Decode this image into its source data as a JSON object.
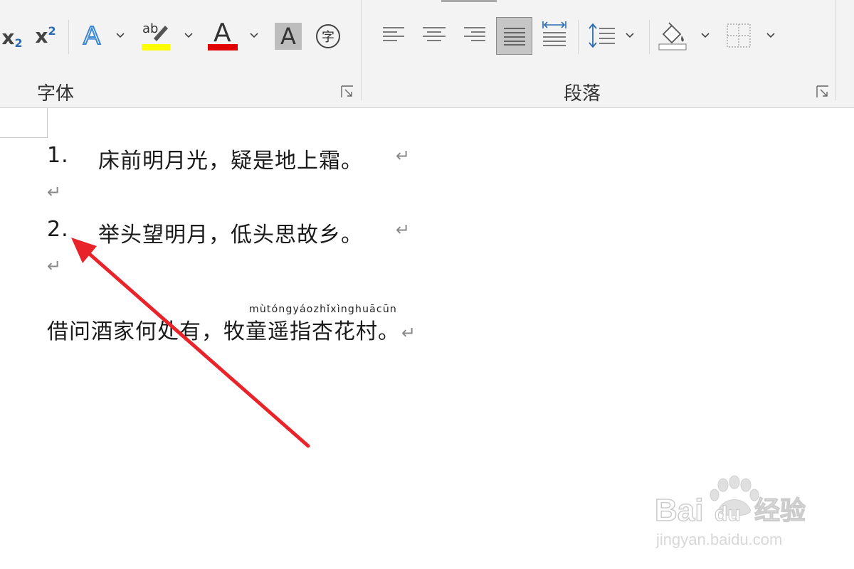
{
  "ribbon": {
    "font_group_label": "字体",
    "paragraph_group_label": "段落",
    "subscript_label": "x",
    "subscript_mark": "2",
    "superscript_label": "x",
    "superscript_mark": "2",
    "text_effects_glyph": "A",
    "highlight_glyph": "ab",
    "font_color_glyph": "A",
    "char_shading_glyph": "A",
    "enclose_char_glyph": "字",
    "highlight_color": "#ffff00",
    "font_color": "#e00000"
  },
  "document": {
    "list_items": [
      {
        "number": "1.",
        "text": "床前明月光，疑是地上霜。"
      },
      {
        "number": "2.",
        "text": "举头望明月，低头思故乡。"
      }
    ],
    "paragraph_mark": "↵",
    "last_line_before": "借问酒家何处有，",
    "last_line_ruby_base": "牧童遥指杏花村",
    "last_line_after": "。",
    "pinyin": "mùtóngyáozhǐxìnghuācūn"
  },
  "annotation": {
    "arrow_color": "#e8232a"
  },
  "watermark": {
    "brand": "Baidu",
    "brand_suffix": "经验",
    "url": "jingyan.baidu.com"
  }
}
